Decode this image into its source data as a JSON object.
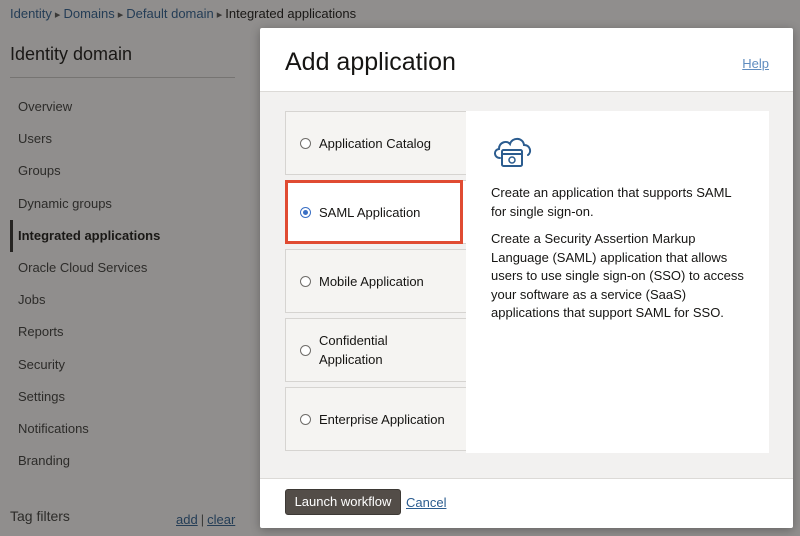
{
  "breadcrumb": {
    "items": [
      "Identity",
      "Domains",
      "Default domain"
    ],
    "current": "Integrated applications"
  },
  "sidebar": {
    "title": "Identity domain",
    "items": [
      {
        "label": "Overview"
      },
      {
        "label": "Users"
      },
      {
        "label": "Groups"
      },
      {
        "label": "Dynamic groups"
      },
      {
        "label": "Integrated applications",
        "active": true
      },
      {
        "label": "Oracle Cloud Services"
      },
      {
        "label": "Jobs"
      },
      {
        "label": "Reports"
      },
      {
        "label": "Security"
      },
      {
        "label": "Settings"
      },
      {
        "label": "Notifications"
      },
      {
        "label": "Branding"
      }
    ]
  },
  "tag_filters": {
    "label": "Tag filters",
    "add": "add",
    "separator": "|",
    "clear": "clear"
  },
  "dialog": {
    "title": "Add application",
    "help": "Help",
    "options": [
      {
        "label": "Application Catalog",
        "selected": false
      },
      {
        "label": "SAML Application",
        "selected": true
      },
      {
        "label": "Mobile Application",
        "selected": false
      },
      {
        "label": "Confidential Application",
        "selected": false
      },
      {
        "label": "Enterprise Application",
        "selected": false
      }
    ],
    "detail": {
      "icon": "cloud-app-icon",
      "summary": "Create an application that supports SAML for single sign-on.",
      "description": "Create a Security Assertion Markup Language (SAML) application that allows users to use single sign-on (SSO) to access your software as a service (SaaS) applications that support SAML for SSO."
    },
    "launch_button": "Launch workflow",
    "cancel": "Cancel"
  },
  "colors": {
    "highlight": "#e04b32",
    "radio_selected": "#3a6fc4",
    "link": "#2b5c8f",
    "primary_button": "#534d48"
  }
}
